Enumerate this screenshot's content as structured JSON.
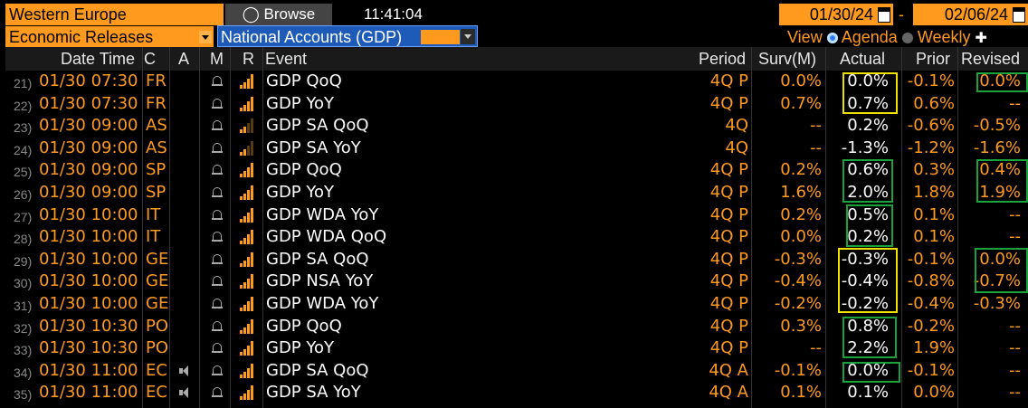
{
  "toolbar": {
    "region": "Western Europe",
    "browse_label": "Browse",
    "time": "11:41:04",
    "date_from": "01/30/24",
    "date_sep": "-",
    "date_to": "02/06/24",
    "category": "Economic Releases",
    "subcategory": "National Accounts (GDP)",
    "view_label": "View",
    "view_agenda": "Agenda",
    "view_weekly": "Weekly"
  },
  "columns": {
    "date_time": "Date Time",
    "country": "C",
    "a": "A",
    "m": "M",
    "r": "R",
    "event": "Event",
    "period": "Period",
    "survey": "Surv(M)",
    "actual": "Actual",
    "prior": "Prior",
    "revised": "Revised"
  },
  "rows": [
    {
      "n": "21)",
      "dt": "01/30 07:30",
      "c": "FR",
      "event": "GDP QoQ",
      "period": "4Q P",
      "surv": "0.0%",
      "actual": "0.0%",
      "prior": "-0.1%",
      "revised": "0.0%"
    },
    {
      "n": "22)",
      "dt": "01/30 07:30",
      "c": "FR",
      "event": "GDP YoY",
      "period": "4Q P",
      "surv": "0.7%",
      "actual": "0.7%",
      "prior": "0.6%",
      "revised": "--"
    },
    {
      "n": "23)",
      "dt": "01/30 09:00",
      "c": "AS",
      "event": "GDP SA QoQ",
      "period": "4Q",
      "surv": "--",
      "actual": "0.2%",
      "prior": "-0.6%",
      "revised": "-0.5%"
    },
    {
      "n": "24)",
      "dt": "01/30 09:00",
      "c": "AS",
      "event": "GDP SA YoY",
      "period": "4Q",
      "surv": "--",
      "actual": "-1.3%",
      "prior": "-1.2%",
      "revised": "-1.6%"
    },
    {
      "n": "25)",
      "dt": "01/30 09:00",
      "c": "SP",
      "event": "GDP QoQ",
      "period": "4Q P",
      "surv": "0.2%",
      "actual": "0.6%",
      "prior": "0.3%",
      "revised": "0.4%"
    },
    {
      "n": "26)",
      "dt": "01/30 09:00",
      "c": "SP",
      "event": "GDP YoY",
      "period": "4Q P",
      "surv": "1.6%",
      "actual": "2.0%",
      "prior": "1.8%",
      "revised": "1.9%"
    },
    {
      "n": "27)",
      "dt": "01/30 10:00",
      "c": "IT",
      "event": "GDP WDA YoY",
      "period": "4Q P",
      "surv": "0.2%",
      "actual": "0.5%",
      "prior": "0.1%",
      "revised": "--"
    },
    {
      "n": "28)",
      "dt": "01/30 10:00",
      "c": "IT",
      "event": "GDP WDA QoQ",
      "period": "4Q P",
      "surv": "0.0%",
      "actual": "0.2%",
      "prior": "0.1%",
      "revised": "--"
    },
    {
      "n": "29)",
      "dt": "01/30 10:00",
      "c": "GE",
      "event": "GDP SA QoQ",
      "period": "4Q P",
      "surv": "-0.3%",
      "actual": "-0.3%",
      "prior": "-0.1%",
      "revised": "0.0%"
    },
    {
      "n": "30)",
      "dt": "01/30 10:00",
      "c": "GE",
      "event": "GDP NSA YoY",
      "period": "4Q P",
      "surv": "-0.4%",
      "actual": "-0.4%",
      "prior": "-0.8%",
      "revised": "-0.7%"
    },
    {
      "n": "31)",
      "dt": "01/30 10:00",
      "c": "GE",
      "event": "GDP WDA YoY",
      "period": "4Q P",
      "surv": "-0.2%",
      "actual": "-0.2%",
      "prior": "-0.4%",
      "revised": "-0.3%"
    },
    {
      "n": "32)",
      "dt": "01/30 10:30",
      "c": "PO",
      "event": "GDP QoQ",
      "period": "4Q P",
      "surv": "0.3%",
      "actual": "0.8%",
      "prior": "-0.2%",
      "revised": "--"
    },
    {
      "n": "33)",
      "dt": "01/30 10:30",
      "c": "PO",
      "event": "GDP YoY",
      "period": "4Q P",
      "surv": "--",
      "actual": "2.2%",
      "prior": "1.9%",
      "revised": "--"
    },
    {
      "n": "34)",
      "dt": "01/30 11:00",
      "c": "EC",
      "event": "GDP SA QoQ",
      "period": "4Q A",
      "surv": "-0.1%",
      "actual": "0.0%",
      "prior": "-0.1%",
      "revised": "--"
    },
    {
      "n": "35)",
      "dt": "01/30 11:00",
      "c": "EC",
      "event": "GDP SA YoY",
      "period": "4Q A",
      "surv": "0.1%",
      "actual": "0.1%",
      "prior": "0.0%",
      "revised": "--"
    }
  ],
  "colors": {
    "accent": "#ff9a1f",
    "highlight_yellow": "#f0e000",
    "highlight_green": "#19a33a",
    "selected_blue": "#1e5bb8"
  }
}
